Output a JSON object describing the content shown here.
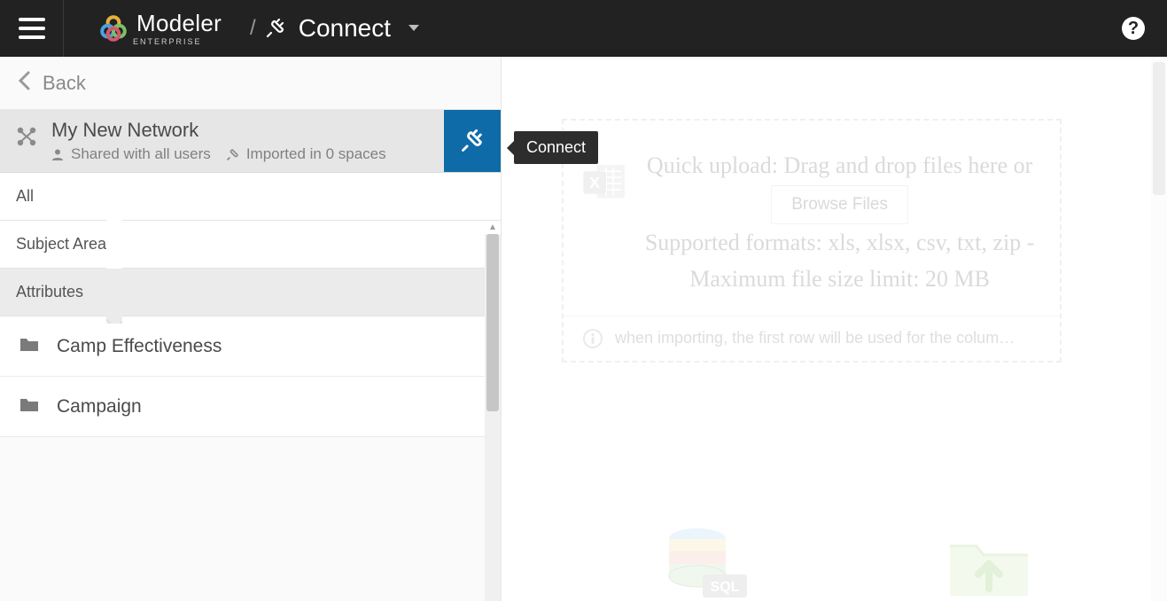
{
  "header": {
    "brand_name": "Modeler",
    "brand_sub": "ENTERPRISE",
    "crumb_separator": "/",
    "crumb_label": "Connect"
  },
  "sidebar": {
    "back_label": "Back",
    "network_title": "My New Network",
    "shared_label": "Shared with all users",
    "imported_label": "Imported in 0 spaces",
    "connect_tooltip": "Connect",
    "filters": {
      "all": "All",
      "subject_area": "Subject Area",
      "attributes": "Attributes"
    },
    "folders": [
      {
        "label": "Camp Effectiveness"
      },
      {
        "label": "Campaign"
      }
    ]
  },
  "main": {
    "upload_line1": "Quick upload: Drag and drop files here or",
    "browse_label": "Browse Files",
    "upload_line2": "Supported formats: xls, xlsx, csv, txt, zip - Maximum file size limit: 20 MB",
    "note": "when importing, the first row will be used for the colum…"
  }
}
